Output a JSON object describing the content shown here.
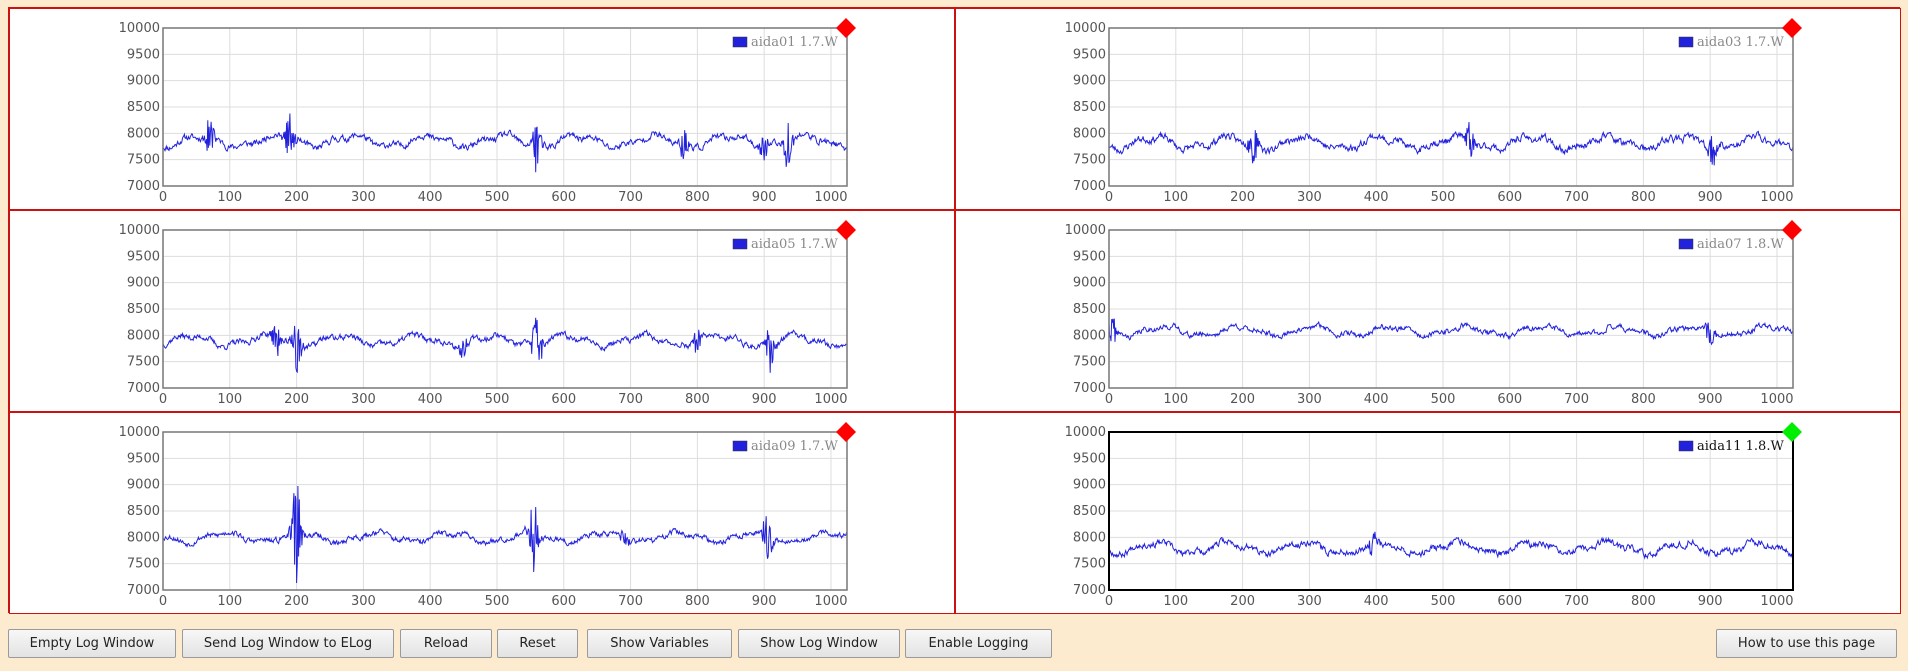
{
  "chart_data": [
    {
      "type": "line",
      "legend": "aida01 1.7.W",
      "status": "red",
      "ylim": [
        7000,
        10000
      ],
      "xlim": [
        0,
        1024
      ],
      "yticks": [
        7000,
        7500,
        8000,
        8500,
        9000,
        9500,
        10000
      ],
      "xticks": [
        0,
        100,
        200,
        300,
        400,
        500,
        600,
        700,
        800,
        900,
        1000
      ],
      "series": [
        {
          "name": "aida01 1.7.W",
          "baseline": 7850,
          "noise": 110,
          "bursts": [
            [
              70,
              380
            ],
            [
              190,
              550
            ],
            [
              560,
              560
            ],
            [
              780,
              320
            ],
            [
              900,
              250
            ],
            [
              935,
              500
            ]
          ],
          "seed": 11
        }
      ]
    },
    {
      "type": "line",
      "legend": "aida03 1.7.W",
      "status": "red",
      "ylim": [
        7000,
        10000
      ],
      "xlim": [
        0,
        1024
      ],
      "yticks": [
        7000,
        7500,
        8000,
        8500,
        9000,
        9500,
        10000
      ],
      "xticks": [
        0,
        100,
        200,
        300,
        400,
        500,
        600,
        700,
        800,
        900,
        1000
      ],
      "series": [
        {
          "name": "aida03 1.7.W",
          "baseline": 7820,
          "noise": 120,
          "bursts": [
            [
              215,
              400
            ],
            [
              540,
              400
            ],
            [
              905,
              350
            ]
          ],
          "seed": 23
        }
      ]
    },
    {
      "type": "line",
      "legend": "aida05 1.7.W",
      "status": "red",
      "ylim": [
        7000,
        10000
      ],
      "xlim": [
        0,
        1024
      ],
      "yticks": [
        7000,
        7500,
        8000,
        8500,
        9000,
        9500,
        10000
      ],
      "xticks": [
        0,
        100,
        200,
        300,
        400,
        500,
        600,
        700,
        800,
        900,
        1000
      ],
      "series": [
        {
          "name": "aida05 1.7.W",
          "baseline": 7900,
          "noise": 100,
          "bursts": [
            [
              170,
              350
            ],
            [
              200,
              700
            ],
            [
              450,
              250
            ],
            [
              560,
              650
            ],
            [
              800,
              250
            ],
            [
              910,
              600
            ]
          ],
          "seed": 37
        }
      ]
    },
    {
      "type": "line",
      "legend": "aida07 1.8.W",
      "status": "red",
      "ylim": [
        7000,
        10000
      ],
      "xlim": [
        0,
        1024
      ],
      "yticks": [
        7000,
        7500,
        8000,
        8500,
        9000,
        9500,
        10000
      ],
      "xticks": [
        0,
        100,
        200,
        300,
        400,
        500,
        600,
        700,
        800,
        900,
        1000
      ],
      "series": [
        {
          "name": "aida07 1.8.W",
          "baseline": 8080,
          "noise": 90,
          "bursts": [
            [
              5,
              300
            ],
            [
              900,
              250
            ]
          ],
          "seed": 41
        }
      ]
    },
    {
      "type": "line",
      "legend": "aida09 1.7.W",
      "status": "red",
      "ylim": [
        7000,
        10000
      ],
      "xlim": [
        0,
        1024
      ],
      "yticks": [
        7000,
        7500,
        8000,
        8500,
        9000,
        9500,
        10000
      ],
      "xticks": [
        0,
        100,
        200,
        300,
        400,
        500,
        600,
        700,
        800,
        900,
        1000
      ],
      "series": [
        {
          "name": "aida09 1.7.W",
          "baseline": 8000,
          "noise": 95,
          "bursts": [
            [
              200,
              1000
            ],
            [
              555,
              750
            ],
            [
              905,
              650
            ],
            [
              690,
              200
            ]
          ],
          "seed": 53
        }
      ]
    },
    {
      "type": "line",
      "legend": "aida11 1.8.W",
      "status": "green",
      "ylim": [
        7000,
        10000
      ],
      "xlim": [
        0,
        1024
      ],
      "yticks": [
        7000,
        7500,
        8000,
        8500,
        9000,
        9500,
        10000
      ],
      "xticks": [
        0,
        100,
        200,
        300,
        400,
        500,
        600,
        700,
        800,
        900,
        1000
      ],
      "series": [
        {
          "name": "aida11 1.8.W",
          "baseline": 7800,
          "noise": 110,
          "bursts": [
            [
              395,
              300
            ]
          ],
          "seed": 67
        }
      ]
    }
  ],
  "colors": {
    "series": "#2222dd",
    "red": "#ff0000",
    "green": "#00ee00",
    "panel_border": "#cc1111"
  },
  "buttons": {
    "empty_log": "Empty Log Window",
    "send_log": "Send Log Window to ELog",
    "reload": "Reload",
    "reset": "Reset",
    "show_variables": "Show Variables",
    "show_log": "Show Log Window",
    "enable_logging": "Enable Logging",
    "how_to": "How to use this page"
  }
}
